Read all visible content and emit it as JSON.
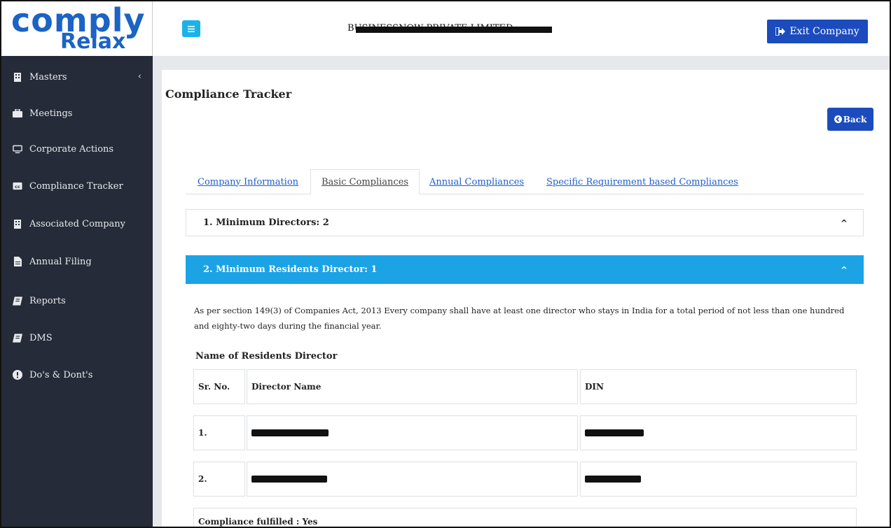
{
  "logo": {
    "main": "comply",
    "sub": "Relax"
  },
  "topbar": {
    "company_name": "BUSINESSNOW PRIVATE LIMITED",
    "exit_label": "Exit Company"
  },
  "sidebar": {
    "items": [
      {
        "label": "Masters",
        "icon": "building-icon",
        "has_chevron": true
      },
      {
        "label": "Meetings",
        "icon": "briefcase-icon"
      },
      {
        "label": "Corporate Actions",
        "icon": "monitor-icon"
      },
      {
        "label": "Compliance Tracker",
        "icon": "cc-icon"
      },
      {
        "label": "Associated Company",
        "icon": "building-icon"
      },
      {
        "label": "Annual Filing",
        "icon": "file-icon"
      },
      {
        "label": "Reports",
        "icon": "book-icon"
      },
      {
        "label": "DMS",
        "icon": "book-icon"
      },
      {
        "label": "Do's & Dont's",
        "icon": "exclamation-icon"
      }
    ]
  },
  "page": {
    "title": "Compliance Tracker",
    "back_label": "Back"
  },
  "tabs": [
    {
      "label": "Company Information",
      "active": false
    },
    {
      "label": "Basic Compliances",
      "active": true
    },
    {
      "label": "Annual Compliances",
      "active": false
    },
    {
      "label": "Specific Requirement based Compliances",
      "active": false
    }
  ],
  "accordion": {
    "item1": {
      "title": "1. Minimum Directors: 2"
    },
    "item2": {
      "title": "2. Minimum Residents Director: 1",
      "description": "As per section 149(3) of Companies Act, 2013 Every company shall have at least one director who stays in India for a total period of not less than one hundred and eighty-two days during the financial year.",
      "subtitle": "Name of Residents Director",
      "table": {
        "headers": [
          "Sr. No.",
          "Director Name",
          "DIN"
        ],
        "rows": [
          {
            "sr": "1.",
            "name": "[redacted]",
            "din": "[redacted]"
          },
          {
            "sr": "2.",
            "name": "[redacted]",
            "din": "[redacted]"
          }
        ]
      },
      "fulfilled": "Compliance fulfilled : Yes"
    }
  },
  "colors": {
    "sidebar_bg": "#252b38",
    "primary_button": "#1b4bbd",
    "accent": "#1ba3e6",
    "link": "#1f5fcf"
  }
}
